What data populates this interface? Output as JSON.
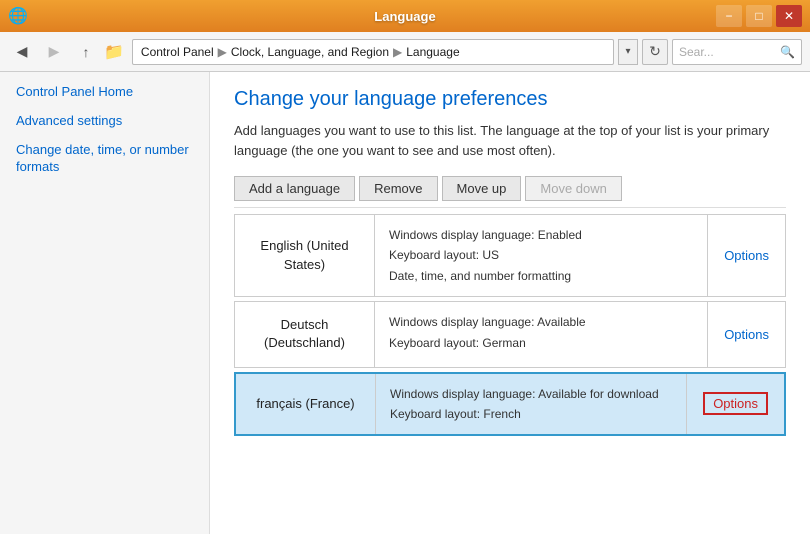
{
  "titlebar": {
    "title": "Language",
    "icon_char": "🌐",
    "min_label": "−",
    "max_label": "□",
    "close_label": "✕"
  },
  "addressbar": {
    "back_label": "◀",
    "forward_label": "▶",
    "up_label": "↑",
    "folder_icon": "📁",
    "path": [
      {
        "label": "Control Panel"
      },
      {
        "label": "Clock, Language, and Region"
      },
      {
        "label": "Language"
      }
    ],
    "dropdown_label": "▾",
    "refresh_label": "↻",
    "search_placeholder": "Sear...",
    "search_icon": "🔍"
  },
  "sidebar": {
    "home_link": "Control Panel Home",
    "links": [
      {
        "label": "Advanced settings"
      },
      {
        "label": "Change date, time, or number formats"
      }
    ]
  },
  "content": {
    "title": "Change your language preferences",
    "description": "Add languages you want to use to this list. The language at the top of your list is your primary language (the one you want to see and use most often).",
    "toolbar": {
      "add_label": "Add a language",
      "remove_label": "Remove",
      "move_up_label": "Move up",
      "move_down_label": "Move down"
    },
    "languages": [
      {
        "name": "English (United States)",
        "detail1": "Windows display language: Enabled",
        "detail2": "Keyboard layout: US",
        "detail3": "Date, time, and number formatting",
        "options_label": "Options",
        "selected": false
      },
      {
        "name": "Deutsch (Deutschland)",
        "detail1": "Windows display language: Available",
        "detail2": "Keyboard layout: German",
        "detail3": "",
        "options_label": "Options",
        "selected": false
      },
      {
        "name": "français (France)",
        "detail1": "Windows display language: Available for download",
        "detail2": "Keyboard layout: French",
        "detail3": "",
        "options_label": "Options",
        "selected": true
      }
    ]
  }
}
